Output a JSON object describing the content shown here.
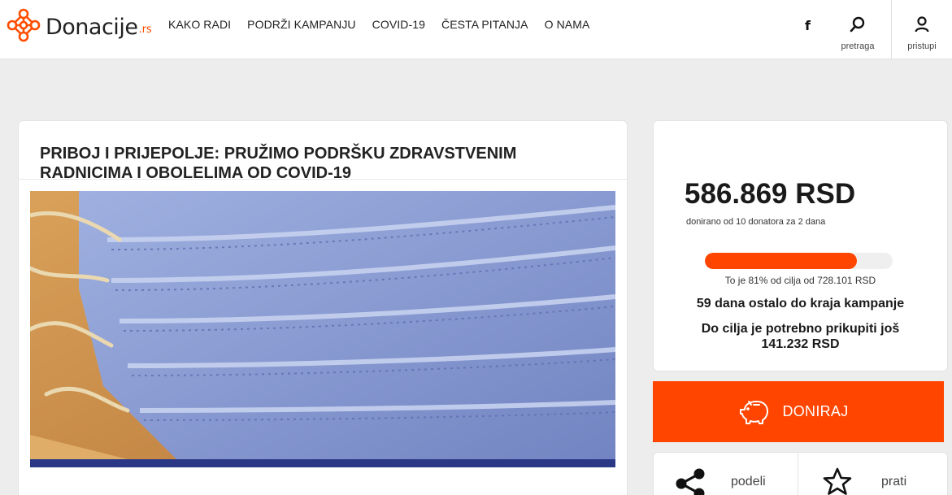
{
  "header": {
    "logo_text": "Donacije",
    "logo_tld": ".rs",
    "nav": [
      "KAKO RADI",
      "PODRŽI KAMPANJU",
      "COVID-19",
      "ČESTA PITANJA",
      "O NAMA"
    ],
    "facebook_label": "f",
    "search_label": "pretraga",
    "login_label": "pristupi"
  },
  "campaign": {
    "title": "PRIBOJ I PRIJEPOLJE: PRUŽIMO PODRŠKU ZDRAVSTVENIM RADNICIMA I OBOLELIMA OD COVID-19"
  },
  "stats": {
    "amount": "586.869 RSD",
    "donors_text": "donirano od 10 donatora za 2 dana",
    "progress_percent": 81,
    "percent_text": "To je 81% od cilja od 728.101 RSD",
    "days_left": "59 dana ostalo do kraja kampanje",
    "remaining": "Do cilja je potrebno prikupiti još 141.232 RSD"
  },
  "actions": {
    "donate_label": "DONIRAJ",
    "share_label": "podeli",
    "follow_label": "prati"
  },
  "colors": {
    "accent": "#ff4500",
    "hero_bar": "#2a3885"
  },
  "icons": [
    "logo-icon",
    "facebook-icon",
    "search-icon",
    "user-icon",
    "piggy-bank-icon",
    "share-icon",
    "star-icon"
  ]
}
